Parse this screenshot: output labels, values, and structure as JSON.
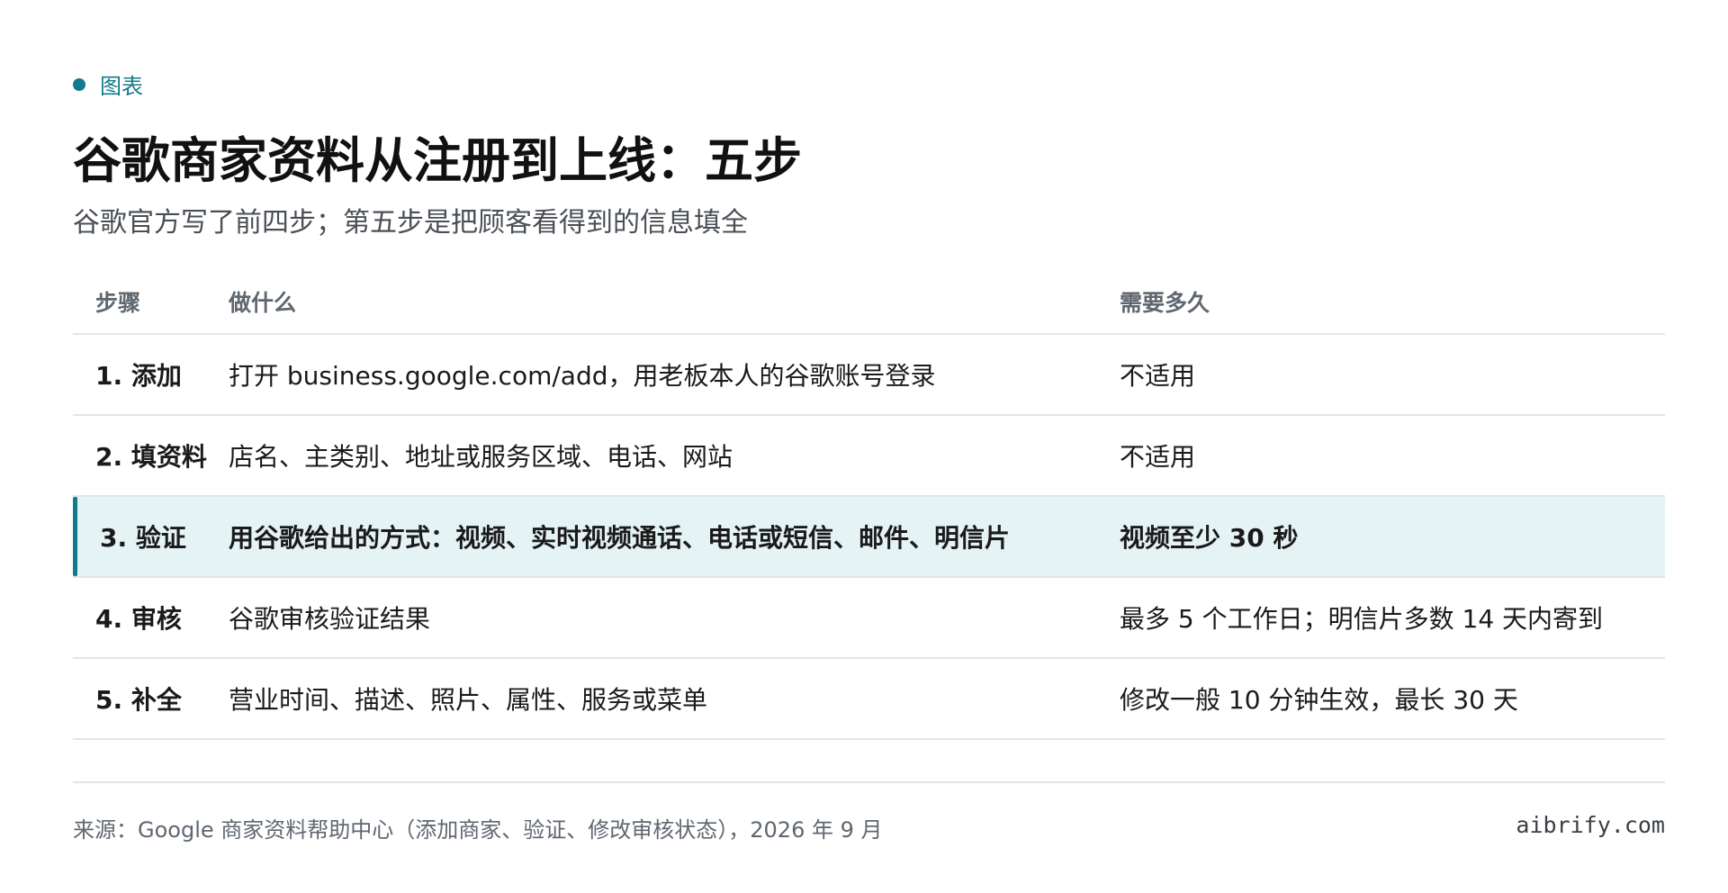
{
  "tag": {
    "label": "图表",
    "color": "#127a8a"
  },
  "title": "谷歌商家资料从注册到上线：五步",
  "subtitle": "谷歌官方写了前四步；第五步是把顾客看得到的信息填全",
  "table": {
    "headers": [
      "步骤",
      "做什么",
      "需要多久"
    ],
    "rows": [
      {
        "step": "1. 添加",
        "what": "打开 business.google.com/add，用老板本人的谷歌账号登录",
        "time": "不适用",
        "highlight": false
      },
      {
        "step": "2. 填资料",
        "what": "店名、主类别、地址或服务区域、电话、网站",
        "time": "不适用",
        "highlight": false
      },
      {
        "step": "3. 验证",
        "what": "用谷歌给出的方式：视频、实时视频通话、电话或短信、邮件、明信片",
        "time": "视频至少 30 秒",
        "highlight": true
      },
      {
        "step": "4. 审核",
        "what": "谷歌审核验证结果",
        "time": "最多 5 个工作日；明信片多数 14 天内寄到",
        "highlight": false
      },
      {
        "step": "5. 补全",
        "what": "营业时间、描述、照片、属性、服务或菜单",
        "time": "修改一般 10 分钟生效，最长 30 天",
        "highlight": false
      }
    ]
  },
  "footer": {
    "source": "来源：Google 商家资料帮助中心（添加商家、验证、修改审核状态），2026 年 9 月",
    "brand": "aibrify.com"
  },
  "colors": {
    "accent": "#127a8a",
    "highlight_bg": "#e5f3f4"
  }
}
